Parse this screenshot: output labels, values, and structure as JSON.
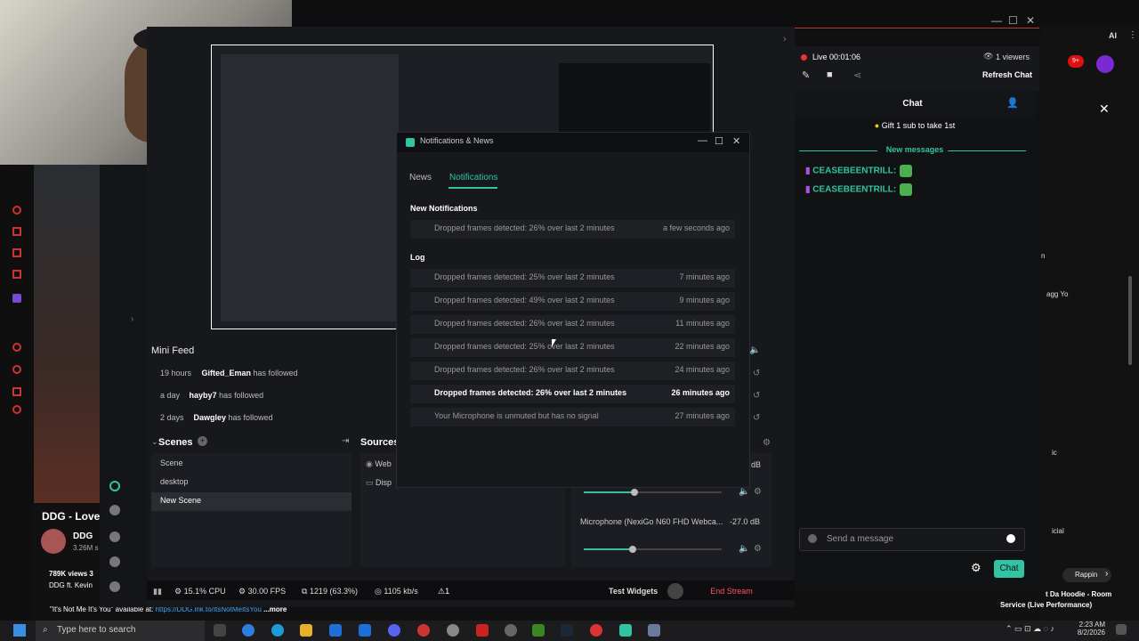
{
  "browser": {
    "video_title": "DDG - Love",
    "channel": "DDG",
    "subs": "3.26M s",
    "views": "789K views 3",
    "desc_line": "DDG ft. Kevin",
    "desc_text": "\"It's Not Me It's You\" available at:",
    "desc_link": "https://DDG.lnk.to/ItsNotMeItsYou",
    "more": "...more",
    "right_snippets": [
      "n",
      "agg Yo",
      "ic",
      "icial",
      "Rappin"
    ],
    "bottom_snippet_1": "t Da Hoodie - Room",
    "bottom_snippet_2": "Service (Live Performance)",
    "notif_count": "9+",
    "ai_label": "AI"
  },
  "minifeed": {
    "title": "Mini Feed",
    "rows": [
      {
        "time": "19 hours",
        "user": "Gifted_Eman",
        "action": "has followed"
      },
      {
        "time": "a day",
        "user": "hayby7",
        "action": "has followed"
      },
      {
        "time": "2 days",
        "user": "Dawgley",
        "action": "has followed"
      }
    ]
  },
  "scenes": {
    "title": "Scenes",
    "items": [
      "Scene",
      "desktop",
      "New Scene"
    ]
  },
  "sources": {
    "title": "Sources",
    "items": [
      "Web",
      "Disp"
    ]
  },
  "mixer": {
    "db_top": "dB",
    "mic_label": "Microphone (NexiGo N60 FHD Webca...",
    "mic_db": "-27.0 dB"
  },
  "statusbar": {
    "cpu": "15.1% CPU",
    "fps": "30.00 FPS",
    "dropped": "1219 (63.3%)",
    "bitrate": "1105 kb/s",
    "alert": "1",
    "test_widgets": "Test Widgets",
    "end_stream": "End Stream"
  },
  "notifications": {
    "window_title": "Notifications & News",
    "tabs": [
      "News",
      "Notifications"
    ],
    "new_title": "New Notifications",
    "new_items": [
      {
        "text": "Dropped frames detected: 26% over last 2 minutes",
        "time": "a few seconds ago"
      }
    ],
    "log_title": "Log",
    "log_items": [
      {
        "text": "Dropped frames detected: 25% over last 2 minutes",
        "time": "7 minutes ago"
      },
      {
        "text": "Dropped frames detected: 49% over last 2 minutes",
        "time": "9 minutes ago"
      },
      {
        "text": "Dropped frames detected: 26% over last 2 minutes",
        "time": "11 minutes ago"
      },
      {
        "text": "Dropped frames detected: 25% over last 2 minutes",
        "time": "22 minutes ago"
      },
      {
        "text": "Dropped frames detected: 26% over last 2 minutes",
        "time": "24 minutes ago"
      },
      {
        "text": "Dropped frames detected: 26% over last 2 minutes",
        "time": "26 minutes ago"
      },
      {
        "text": "Your Microphone is unmuted but has no signal",
        "time": "27 minutes ago"
      }
    ]
  },
  "chat": {
    "live": "Live 00:01:06",
    "viewers": "1 viewers",
    "refresh": "Refresh Chat",
    "title": "Chat",
    "gift": "Gift 1 sub to take 1st",
    "new_messages": "New messages",
    "messages": [
      {
        "user": "CEASEBEENTRILL:"
      },
      {
        "user": "CEASEBEENTRILL:"
      }
    ],
    "input_placeholder": "Send a message",
    "send": "Chat"
  },
  "taskbar": {
    "search": "Type here to search",
    "time": "2:23 AM",
    "date": "8/2/2026"
  }
}
